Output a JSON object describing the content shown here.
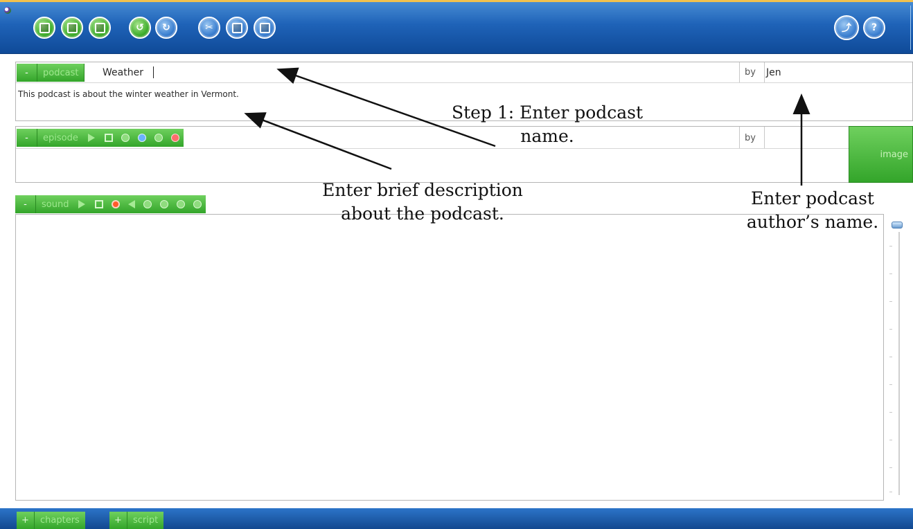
{
  "toolbar": {
    "buttons": [
      {
        "name": "new-file-icon"
      },
      {
        "name": "open-file-icon"
      },
      {
        "name": "save-icon"
      },
      {
        "name": "undo-icon"
      },
      {
        "name": "redo-icon"
      },
      {
        "name": "cut-icon"
      },
      {
        "name": "copy-icon"
      },
      {
        "name": "paste-icon"
      },
      {
        "name": "publish-icon"
      },
      {
        "name": "help-icon"
      }
    ]
  },
  "podcast": {
    "tag_minus": "-",
    "tag_label": "podcast",
    "name_value": "Weather",
    "by_label": "by",
    "author_value": "Jen",
    "description_value": "This podcast is about the winter weather in Vermont."
  },
  "episode": {
    "tag_minus": "-",
    "tag_label": "episode",
    "by_label": "by",
    "author_value": "",
    "image_label": "image"
  },
  "sound": {
    "tag_minus": "-",
    "tag_label": "sound"
  },
  "bottom_tabs": [
    {
      "plus": "+",
      "label": "chapters"
    },
    {
      "plus": "+",
      "label": "script"
    }
  ],
  "annotations": {
    "step1": "Step 1: Enter podcast name.",
    "description": "Enter brief description about the podcast.",
    "author": "Enter podcast author’s name."
  },
  "colors": {
    "toolbar_blue": "#1f63b8",
    "accent_green": "#33a52a",
    "record_red": "#ff5a2a"
  }
}
